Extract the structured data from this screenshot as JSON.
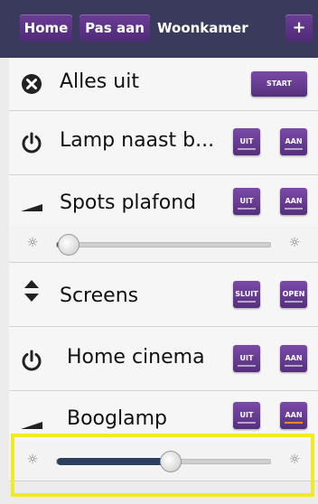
{
  "header": {
    "home_label": "Home",
    "edit_label": "Pas aan",
    "room_title": "Woonkamer",
    "add_label": "+"
  },
  "rows": [
    {
      "label": "Alles uit",
      "icon": "close-circle-icon",
      "button": "START"
    },
    {
      "label": "Lamp naast b...",
      "icon": "power-icon",
      "off": "UIT",
      "on": "AAN"
    },
    {
      "label": "Spots plafond",
      "icon": "dimmer-ramp-icon",
      "off": "UIT",
      "on": "AAN",
      "slider_level": 0.05
    },
    {
      "label": "Screens",
      "icon": "up-down-arrows-icon",
      "off": "SLUIT",
      "on": "OPEN"
    },
    {
      "label": "Home cinema",
      "icon": "power-icon",
      "off": "UIT",
      "on": "AAN"
    },
    {
      "label": "Booglamp",
      "icon": "dimmer-ramp-icon",
      "off": "UIT",
      "on": "AAN",
      "active": "on",
      "slider_level": 0.53
    }
  ],
  "colors": {
    "topbar": "#3a3b5c",
    "button": "#6a3d96",
    "active_indicator": "#f08a1c",
    "slider_fill": "#2b3f5e",
    "highlight": "#f2ea22"
  }
}
